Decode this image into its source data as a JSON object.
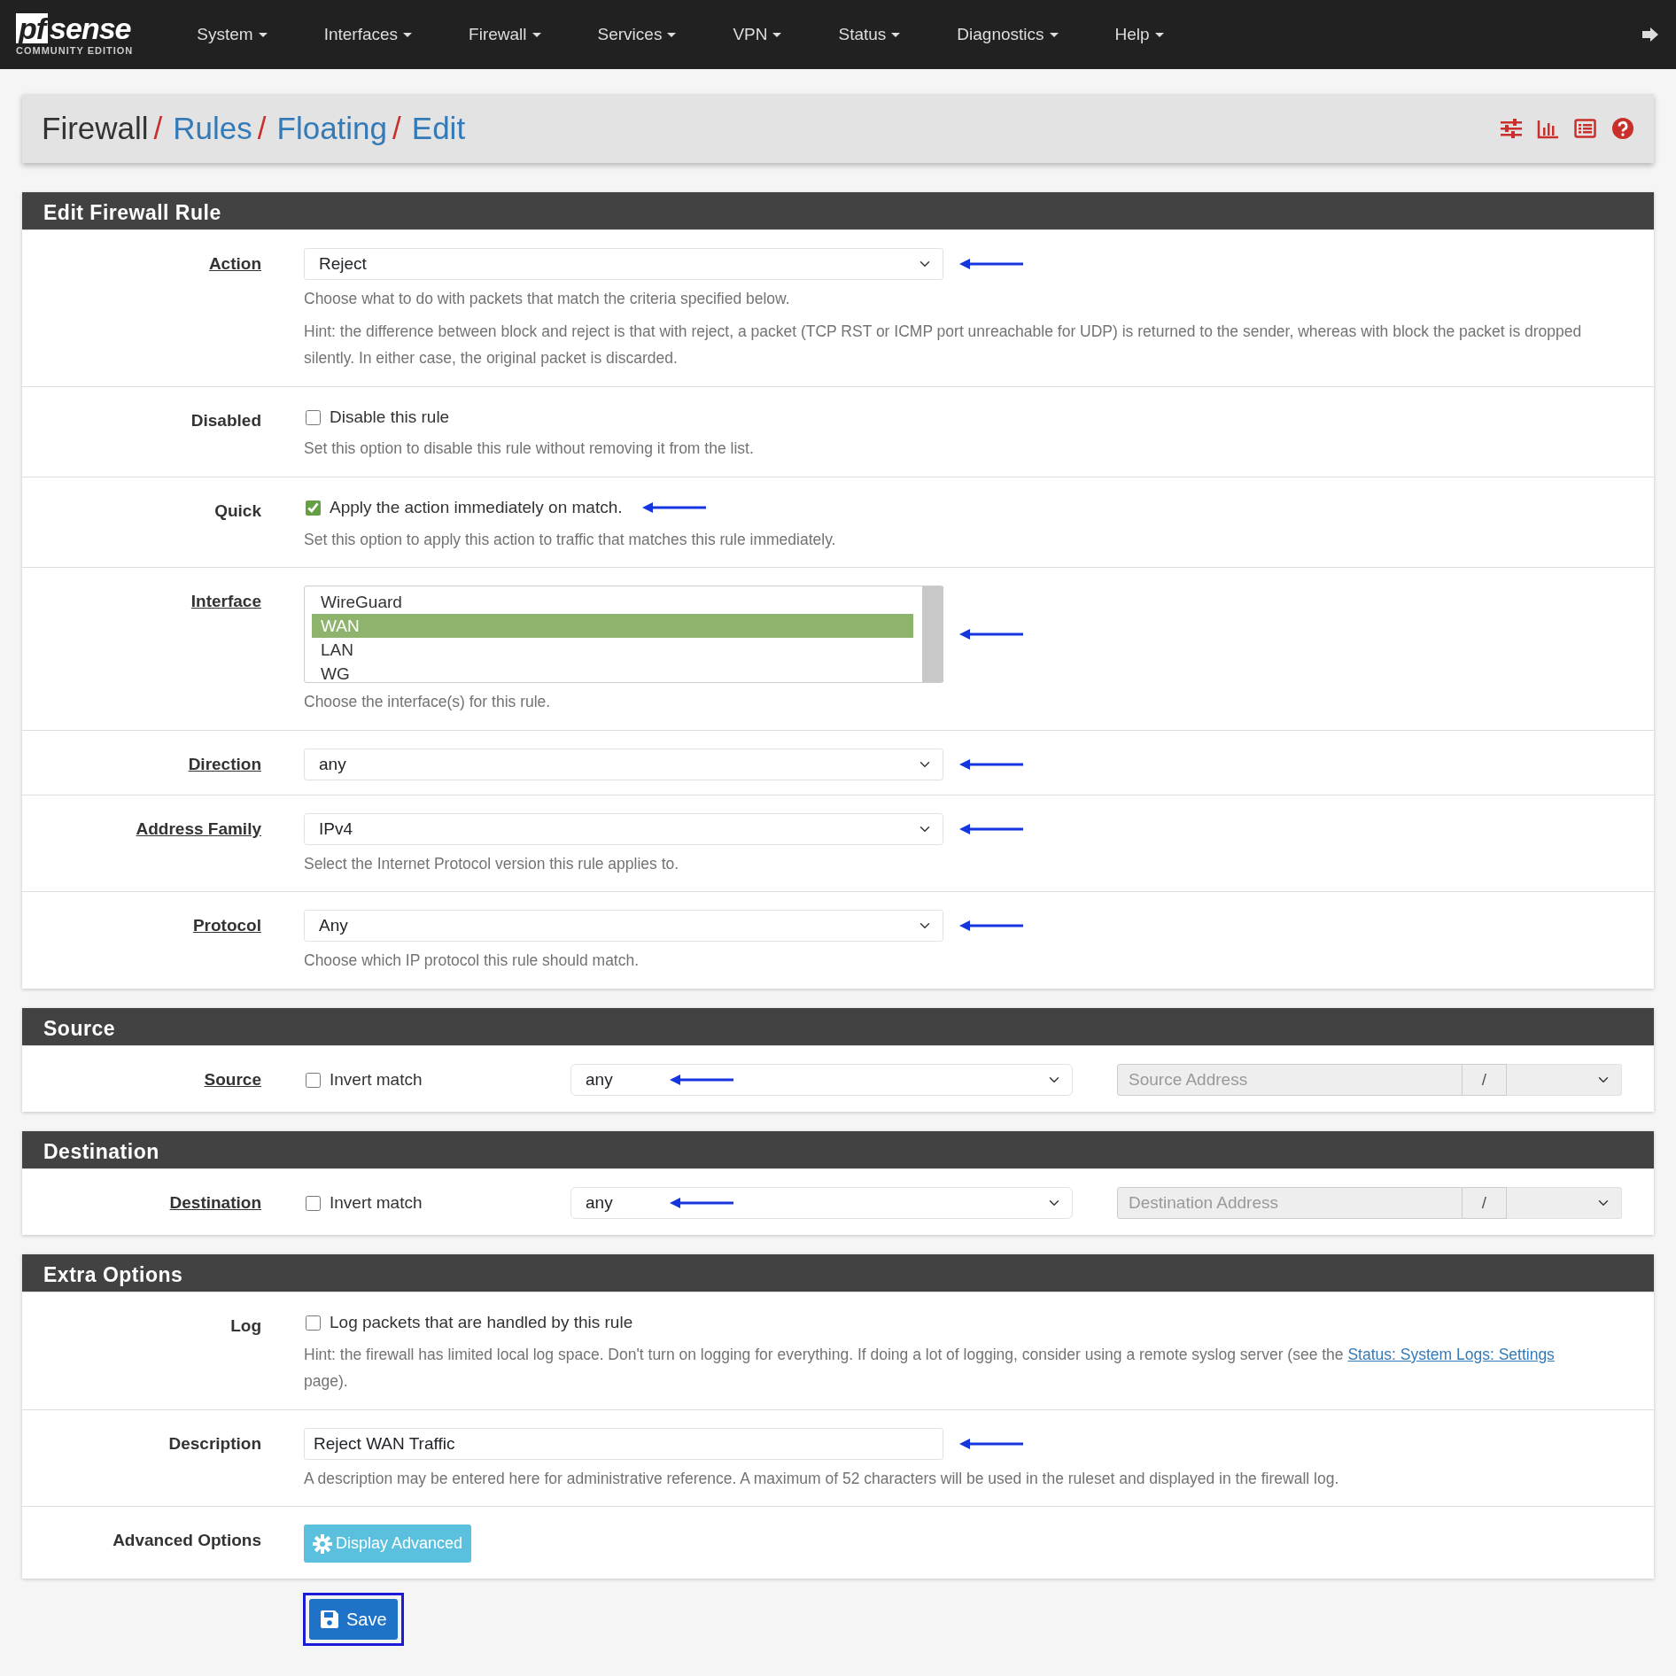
{
  "navbar": {
    "logo_mark": "pf",
    "logo_text": "sense",
    "logo_subtitle": "COMMUNITY EDITION",
    "menus": [
      "System",
      "Interfaces",
      "Firewall",
      "Services",
      "VPN",
      "Status",
      "Diagnostics",
      "Help"
    ]
  },
  "breadcrumb": {
    "separator": "/",
    "items": [
      {
        "label": "Firewall",
        "link": false
      },
      {
        "label": "Rules",
        "link": true
      },
      {
        "label": "Floating",
        "link": true
      },
      {
        "label": "Edit",
        "link": true
      }
    ]
  },
  "sections": [
    {
      "title": "Edit Firewall Rule",
      "rows": [
        {
          "kind": "select",
          "label": "Action",
          "underlined": true,
          "value": "Reject",
          "arrow": true,
          "help": [
            "Choose what to do with packets that match the criteria specified below.",
            "Hint: the difference between block and reject is that with reject, a packet (TCP RST or ICMP port unreachable for UDP) is returned to the sender, whereas with block the packet is dropped silently. In either case, the original packet is discarded."
          ]
        },
        {
          "kind": "checkbox",
          "label": "Disabled",
          "underlined": false,
          "checked": false,
          "text": "Disable this rule",
          "arrow": false,
          "help": [
            "Set this option to disable this rule without removing it from the list."
          ]
        },
        {
          "kind": "checkbox",
          "label": "Quick",
          "underlined": false,
          "checked": true,
          "text": "Apply the action immediately on match.",
          "arrow": true,
          "help": [
            "Set this option to apply this action to traffic that matches this rule immediately."
          ]
        },
        {
          "kind": "listbox",
          "label": "Interface",
          "underlined": true,
          "arrow": true,
          "options": [
            {
              "label": "WireGuard",
              "selected": false
            },
            {
              "label": "WAN",
              "selected": true
            },
            {
              "label": "LAN",
              "selected": false
            },
            {
              "label": "WG",
              "selected": false
            }
          ],
          "help": [
            "Choose the interface(s) for this rule."
          ]
        },
        {
          "kind": "select",
          "label": "Direction",
          "underlined": true,
          "value": "any",
          "arrow": true
        },
        {
          "kind": "select",
          "label": "Address Family",
          "underlined": true,
          "value": "IPv4",
          "arrow": true,
          "help": [
            "Select the Internet Protocol version this rule applies to."
          ]
        },
        {
          "kind": "select",
          "label": "Protocol",
          "underlined": true,
          "value": "Any",
          "arrow": true,
          "help": [
            "Choose which IP protocol this rule should match."
          ]
        }
      ]
    },
    {
      "title": "Source",
      "rows": [
        {
          "kind": "address",
          "label": "Source",
          "underlined": true,
          "checked": false,
          "text": "Invert match",
          "value": "any",
          "arrow": true,
          "placeholder": "Source Address",
          "separator": "/"
        }
      ]
    },
    {
      "title": "Destination",
      "rows": [
        {
          "kind": "address",
          "label": "Destination",
          "underlined": true,
          "checked": false,
          "text": "Invert match",
          "value": "any",
          "arrow": true,
          "placeholder": "Destination Address",
          "separator": "/"
        }
      ]
    },
    {
      "title": "Extra Options",
      "rows": [
        {
          "kind": "checkbox",
          "label": "Log",
          "underlined": false,
          "checked": false,
          "text": "Log packets that are handled by this rule",
          "arrow": false,
          "help_parts": [
            {
              "text": "Hint: the firewall has limited local log space. Don't turn on logging for everything. If doing a lot of logging, consider using a remote syslog server (see the ",
              "link": false
            },
            {
              "text": "Status: System Logs: Settings",
              "link": true
            },
            {
              "text": " page).",
              "link": false
            }
          ]
        },
        {
          "kind": "input",
          "label": "Description",
          "underlined": false,
          "value": "Reject WAN Traffic",
          "arrow": true,
          "help": [
            "A description may be entered here for administrative reference. A maximum of 52 characters will be used in the ruleset and displayed in the firewall log."
          ]
        },
        {
          "kind": "button",
          "label": "Advanced Options",
          "underlined": false,
          "button": "Display Advanced"
        }
      ]
    }
  ],
  "save": {
    "label": "Save",
    "highlighted": true
  }
}
